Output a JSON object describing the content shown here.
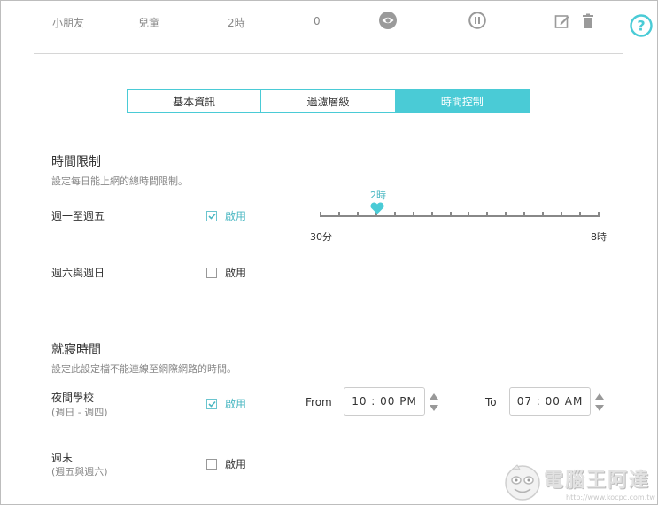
{
  "profile_row": {
    "name": "小朋友",
    "category": "兒童",
    "time": "2時",
    "count": "0"
  },
  "help": {
    "symbol": "?"
  },
  "tabs": [
    {
      "label": "基本資訊",
      "active": false
    },
    {
      "label": "過濾層級",
      "active": false
    },
    {
      "label": "時間控制",
      "active": true
    }
  ],
  "time_limit": {
    "title": "時間限制",
    "desc": "設定每日能上網的總時間限制。",
    "weekday": {
      "label": "週一至週五",
      "enabled": true,
      "enable_label": "啟用"
    },
    "weekend": {
      "label": "週六與週日",
      "enabled": false,
      "enable_label": "啟用"
    },
    "slider": {
      "value_label": "2時",
      "min_label": "30分",
      "max_label": "8時",
      "tick_count": 16,
      "value_tick_index": 3
    }
  },
  "bedtime": {
    "title": "就寢時間",
    "desc": "設定此設定檔不能連線至網際網路的時間。",
    "school_night": {
      "label": "夜間學校",
      "sub": "(週日 - 週四)",
      "enabled": true,
      "enable_label": "啟用",
      "from_label": "From",
      "from_value": "10 : 00  PM",
      "to_label": "To",
      "to_value": "07 : 00  AM"
    },
    "weekend": {
      "label": "週末",
      "sub": "(週五與週六)",
      "enabled": false,
      "enable_label": "啟用"
    }
  },
  "watermark": {
    "text": "電腦王阿達",
    "url": "http://www.kocpc.com.tw"
  },
  "colors": {
    "accent": "#4acbd6",
    "accent_text": "#4ab7c2"
  }
}
